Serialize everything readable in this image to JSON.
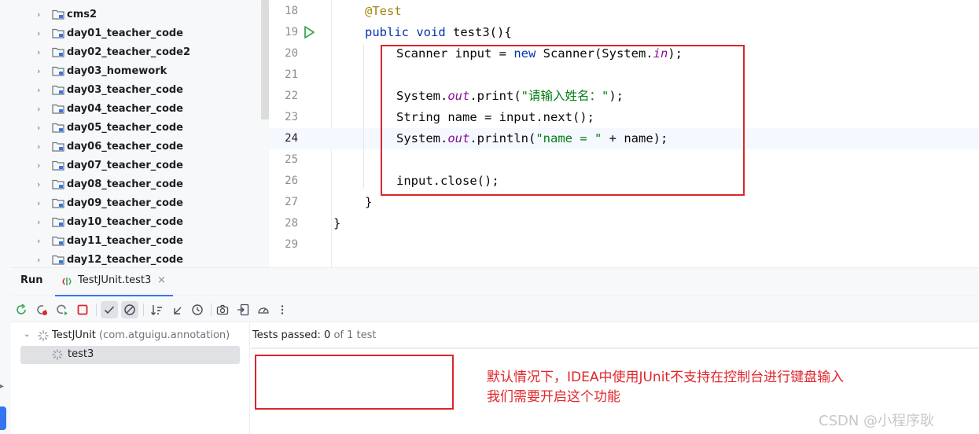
{
  "project_tree": {
    "items": [
      {
        "label": "cms2"
      },
      {
        "label": "day01_teacher_code"
      },
      {
        "label": "day02_teacher_code2"
      },
      {
        "label": "day03_homework"
      },
      {
        "label": "day03_teacher_code"
      },
      {
        "label": "day04_teacher_code"
      },
      {
        "label": "day05_teacher_code"
      },
      {
        "label": "day06_teacher_code"
      },
      {
        "label": "day07_teacher_code"
      },
      {
        "label": "day08_teacher_code"
      },
      {
        "label": "day09_teacher_code"
      },
      {
        "label": "day10_teacher_code"
      },
      {
        "label": "day11_teacher_code"
      },
      {
        "label": "day12_teacher_code"
      }
    ]
  },
  "editor": {
    "current_line": "24",
    "lines": [
      {
        "num": "18"
      },
      {
        "num": "19"
      },
      {
        "num": "20"
      },
      {
        "num": "21"
      },
      {
        "num": "22"
      },
      {
        "num": "23"
      },
      {
        "num": "24"
      },
      {
        "num": "25"
      },
      {
        "num": "26"
      },
      {
        "num": "27"
      },
      {
        "num": "28"
      },
      {
        "num": "29"
      }
    ],
    "code": {
      "l18": "@Test",
      "l19_kw1": "public",
      "l19_kw2": "void",
      "l19_rest": " test3(){",
      "l20_a": "Scanner input = ",
      "l20_kw": "new",
      "l20_b": " Scanner(System.",
      "l20_fld": "in",
      "l20_c": ");",
      "l22_a": "System.",
      "l22_fld": "out",
      "l22_b": ".print(",
      "l22_str": "\"请输入姓名：\"",
      "l22_c": ");",
      "l23": "String name = input.next();",
      "l24_a": "System.",
      "l24_fld": "out",
      "l24_b": ".println(",
      "l24_str": "\"name = \"",
      "l24_c": " + name);",
      "l26": "input.close();",
      "l27": "}",
      "l28": "}"
    }
  },
  "run_panel": {
    "title": "Run",
    "tab_label": "TestJUnit.test3",
    "tab_close": "×",
    "tree": {
      "root_label": "TestJUnit",
      "root_package": "(com.atguigu.annotation)",
      "child_label": "test3"
    },
    "status": {
      "prefix": "Tests passed: ",
      "passed": "0",
      "of_label": " of 1 test"
    }
  },
  "annotation": {
    "line1": "默认情况下，IDEA中使用JUnit不支持在控制台进行键盘输入",
    "line2": "我们需要开启这个功能"
  },
  "watermark": "CSDN @小程序耿",
  "colors": {
    "accent": "#3574f0",
    "highlight_box": "#d9262b",
    "note_text": "#e0262b",
    "keyword": "#0033b3",
    "string": "#067d17",
    "annotation": "#9e880d",
    "static_field": "#871094"
  }
}
